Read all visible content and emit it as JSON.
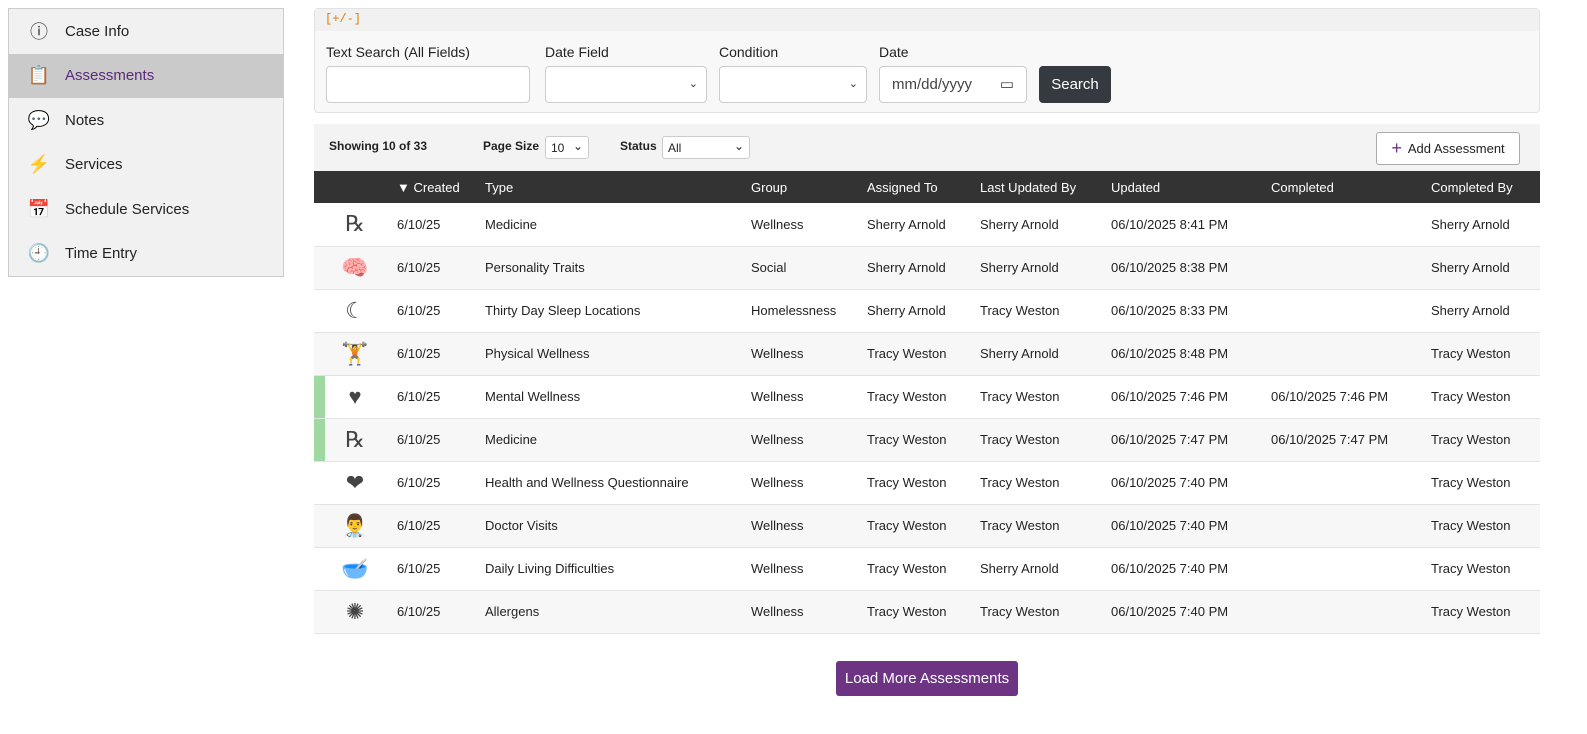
{
  "sidebar": {
    "items": [
      {
        "label": "Case Info",
        "icon": "info-icon",
        "glyph": "ⓘ"
      },
      {
        "label": "Assessments",
        "icon": "clipboard-search-icon",
        "glyph": "📋",
        "active": true
      },
      {
        "label": "Notes",
        "icon": "chat-icon",
        "glyph": "💬"
      },
      {
        "label": "Services",
        "icon": "lightning-icon",
        "glyph": "⚡"
      },
      {
        "label": "Schedule Services",
        "icon": "calendar-icon",
        "glyph": "📅"
      },
      {
        "label": "Time Entry",
        "icon": "clock-icon",
        "glyph": "🕘"
      }
    ]
  },
  "filter": {
    "toggle": "[+/-]",
    "text_label": "Text Search (All Fields)",
    "date_field_label": "Date Field",
    "condition_label": "Condition",
    "date_label": "Date",
    "date_placeholder": "mm/dd/yyyy",
    "search_label": "Search"
  },
  "toolbar": {
    "showing": "Showing 10 of 33",
    "page_size_label": "Page Size",
    "page_size": "10",
    "status_label": "Status",
    "status": "All",
    "add_label": "Add Assessment"
  },
  "table": {
    "headers": [
      "",
      "▼ Created",
      "Type",
      "Group",
      "Assigned To",
      "Last Updated By",
      "Updated",
      "Completed",
      "Completed By"
    ],
    "rows": [
      {
        "icon": "rx-icon",
        "glyph": "℞",
        "marked": false,
        "cells": [
          "6/10/25",
          "Medicine",
          "Wellness",
          "Sherry Arnold",
          "Sherry Arnold",
          "06/10/2025 8:41 PM",
          "",
          "Sherry Arnold"
        ]
      },
      {
        "icon": "head-puzzle-icon",
        "glyph": "🧠",
        "marked": false,
        "cells": [
          "6/10/25",
          "Personality Traits",
          "Social",
          "Sherry Arnold",
          "Sherry Arnold",
          "06/10/2025 8:38 PM",
          "",
          "Sherry Arnold"
        ]
      },
      {
        "icon": "moon-sleep-icon",
        "glyph": "☾",
        "marked": false,
        "cells": [
          "6/10/25",
          "Thirty Day Sleep Locations",
          "Homelessness",
          "Sherry Arnold",
          "Tracy Weston",
          "06/10/2025 8:33 PM",
          "",
          "Sherry Arnold"
        ]
      },
      {
        "icon": "weightlifter-icon",
        "glyph": "🏋",
        "marked": false,
        "cells": [
          "6/10/25",
          "Physical Wellness",
          "Wellness",
          "Tracy Weston",
          "Sherry Arnold",
          "06/10/2025 8:48 PM",
          "",
          "Tracy Weston"
        ]
      },
      {
        "icon": "head-heart-icon",
        "glyph": "♥",
        "marked": true,
        "cells": [
          "6/10/25",
          "Mental Wellness",
          "Wellness",
          "Tracy Weston",
          "Tracy Weston",
          "06/10/2025 7:46 PM",
          "06/10/2025 7:46 PM",
          "Tracy Weston"
        ]
      },
      {
        "icon": "rx-icon",
        "glyph": "℞",
        "marked": true,
        "cells": [
          "6/10/25",
          "Medicine",
          "Wellness",
          "Tracy Weston",
          "Tracy Weston",
          "06/10/2025 7:47 PM",
          "06/10/2025 7:47 PM",
          "Tracy Weston"
        ]
      },
      {
        "icon": "heartbeat-icon",
        "glyph": "❤",
        "marked": false,
        "cells": [
          "6/10/25",
          "Health and Wellness Questionnaire",
          "Wellness",
          "Tracy Weston",
          "Tracy Weston",
          "06/10/2025 7:40 PM",
          "",
          "Tracy Weston"
        ]
      },
      {
        "icon": "doctor-icon",
        "glyph": "👨‍⚕️",
        "marked": false,
        "cells": [
          "6/10/25",
          "Doctor Visits",
          "Wellness",
          "Tracy Weston",
          "Tracy Weston",
          "06/10/2025 7:40 PM",
          "",
          "Tracy Weston"
        ]
      },
      {
        "icon": "bowl-spoon-icon",
        "glyph": "🥣",
        "marked": false,
        "cells": [
          "6/10/25",
          "Daily Living Difficulties",
          "Wellness",
          "Tracy Weston",
          "Sherry Arnold",
          "06/10/2025 7:40 PM",
          "",
          "Tracy Weston"
        ]
      },
      {
        "icon": "virus-icon",
        "glyph": "✺",
        "marked": false,
        "cells": [
          "6/10/25",
          "Allergens",
          "Wellness",
          "Tracy Weston",
          "Tracy Weston",
          "06/10/2025 7:40 PM",
          "",
          "Tracy Weston"
        ]
      }
    ]
  },
  "load_more_label": "Load More Assessments"
}
